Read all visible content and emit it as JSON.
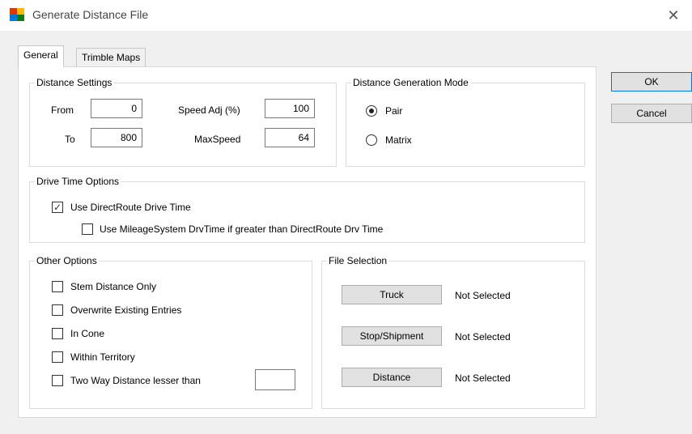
{
  "window": {
    "title": "Generate Distance File"
  },
  "tabs": [
    {
      "label": "General"
    },
    {
      "label": "Trimble Maps"
    }
  ],
  "distance_settings": {
    "title": "Distance Settings",
    "from_label": "From",
    "from_value": "0",
    "to_label": "To",
    "to_value": "800",
    "speed_adj_label": "Speed Adj (%)",
    "speed_adj_value": "100",
    "maxspeed_label": "MaxSpeed",
    "maxspeed_value": "64"
  },
  "generation_mode": {
    "title": "Distance Generation Mode",
    "options": [
      {
        "label": "Pair",
        "selected": true
      },
      {
        "label": "Matrix",
        "selected": false
      }
    ]
  },
  "drive_time": {
    "title": "Drive Time Options",
    "use_directroute": {
      "label": "Use DirectRoute Drive Time",
      "checked": true
    },
    "use_mileage": {
      "label": "Use MileageSystem DrvTime if greater than DirectRoute Drv Time",
      "checked": false
    }
  },
  "other_options": {
    "title": "Other Options",
    "items": [
      {
        "label": "Stem Distance Only",
        "checked": false
      },
      {
        "label": "Overwrite Existing Entries",
        "checked": false
      },
      {
        "label": "In Cone",
        "checked": false
      },
      {
        "label": "Within Territory",
        "checked": false
      },
      {
        "label": "Two Way Distance lesser than",
        "checked": false
      }
    ],
    "two_way_value": ""
  },
  "file_selection": {
    "title": "File Selection",
    "rows": [
      {
        "button": "Truck",
        "status": "Not Selected"
      },
      {
        "button": "Stop/Shipment",
        "status": "Not Selected"
      },
      {
        "button": "Distance",
        "status": "Not Selected"
      }
    ]
  },
  "actions": {
    "ok_label": "OK",
    "cancel_label": "Cancel"
  }
}
